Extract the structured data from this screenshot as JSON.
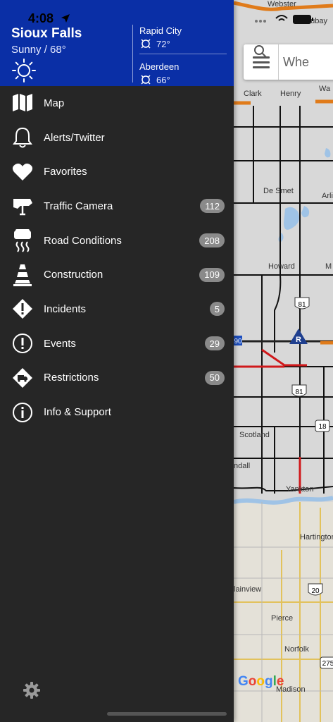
{
  "status": {
    "time": "4:08"
  },
  "weather": {
    "city": "Sioux Falls",
    "condition": "Sunny / 68°",
    "others": [
      {
        "city": "Rapid City",
        "temp": "72°"
      },
      {
        "city": "Aberdeen",
        "temp": "66°"
      }
    ]
  },
  "menu": [
    {
      "label": "Map",
      "icon": "map-icon",
      "badge": ""
    },
    {
      "label": "Alerts/Twitter",
      "icon": "bell-icon",
      "badge": ""
    },
    {
      "label": "Favorites",
      "icon": "heart-icon",
      "badge": ""
    },
    {
      "label": "Traffic Camera",
      "icon": "camera-icon",
      "badge": "112"
    },
    {
      "label": "Road Conditions",
      "icon": "road-conditions-icon",
      "badge": "208"
    },
    {
      "label": "Construction",
      "icon": "cone-icon",
      "badge": "109"
    },
    {
      "label": "Incidents",
      "icon": "incident-icon",
      "badge": "5"
    },
    {
      "label": "Events",
      "icon": "event-icon",
      "badge": "29"
    },
    {
      "label": "Restrictions",
      "icon": "restriction-icon",
      "badge": "50"
    },
    {
      "label": "Info & Support",
      "icon": "info-icon",
      "badge": ""
    }
  ],
  "map": {
    "search_placeholder": "Whe",
    "places": {
      "webster": "Webster",
      "waubay": "Waubay",
      "clark": "Clark",
      "henry": "Henry",
      "wa": "Wa",
      "de_smet": "De Smet",
      "arli": "Arli",
      "howard": "Howard",
      "m": "M",
      "scotland": "Scotland",
      "ndall": "ndall",
      "yankton": "Yankton",
      "hartington": "Hartington",
      "lainview": "lainview",
      "pierce": "Pierce",
      "norfolk": "Norfolk",
      "madison": "Madison"
    },
    "shields": {
      "us81a": "81",
      "us81b": "81",
      "i90": "90",
      "sd18": "18",
      "us20": "20",
      "ne275": "275",
      "rest": "R"
    },
    "attribution": "Google"
  },
  "colors": {
    "header_blue": "#0a2fa6",
    "drawer_bg": "#262626",
    "badge_bg": "#8a8a8a",
    "road_red": "#d0191b"
  }
}
